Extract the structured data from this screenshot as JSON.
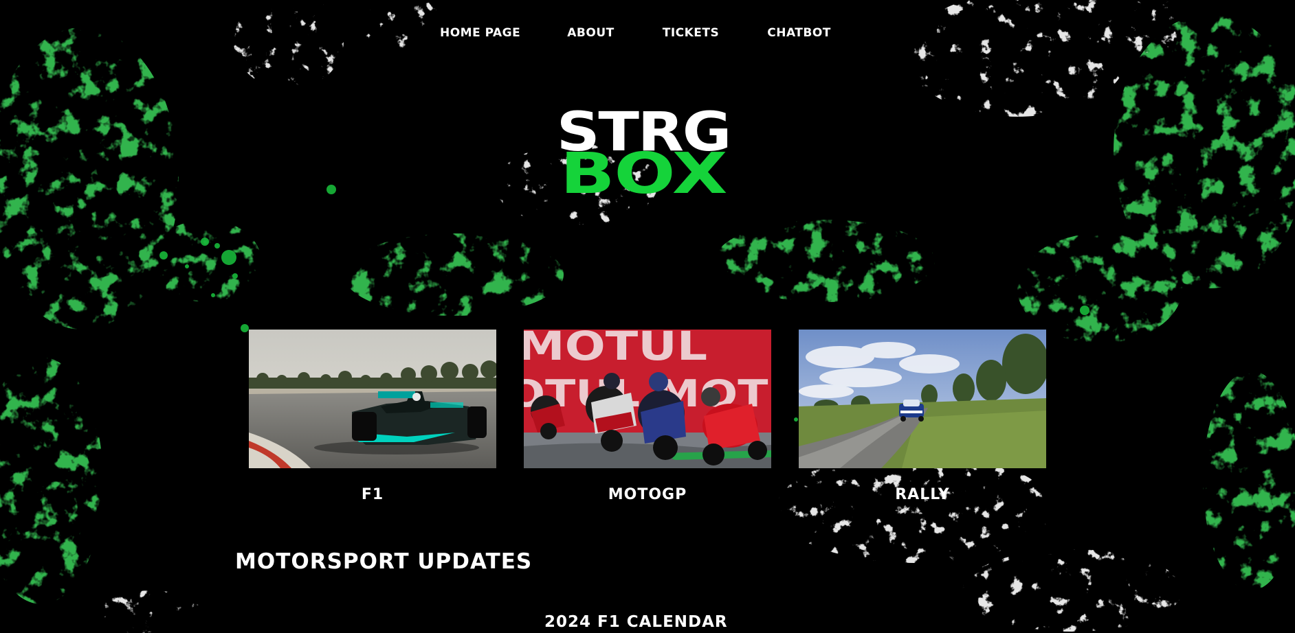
{
  "nav": {
    "items": [
      {
        "label": "HOME PAGE"
      },
      {
        "label": "ABOUT"
      },
      {
        "label": "TICKETS"
      },
      {
        "label": "CHATBOT"
      }
    ]
  },
  "logo": {
    "line1": "STRG",
    "line2": "BOX",
    "line1_color": "#ffffff",
    "line2_color": "#15d33a"
  },
  "categories": [
    {
      "label": "F1",
      "image": "f1-car-photo"
    },
    {
      "label": "MOTOGP",
      "image": "motogp-riders-photo"
    },
    {
      "label": "RALLY",
      "image": "rally-car-photo"
    }
  ],
  "sections": {
    "updates_title": "MOTORSPORT UPDATES",
    "calendar_title": "2024 F1 CALENDAR"
  },
  "colors": {
    "background": "#000000",
    "accent": "#15d33a",
    "text": "#ffffff"
  }
}
